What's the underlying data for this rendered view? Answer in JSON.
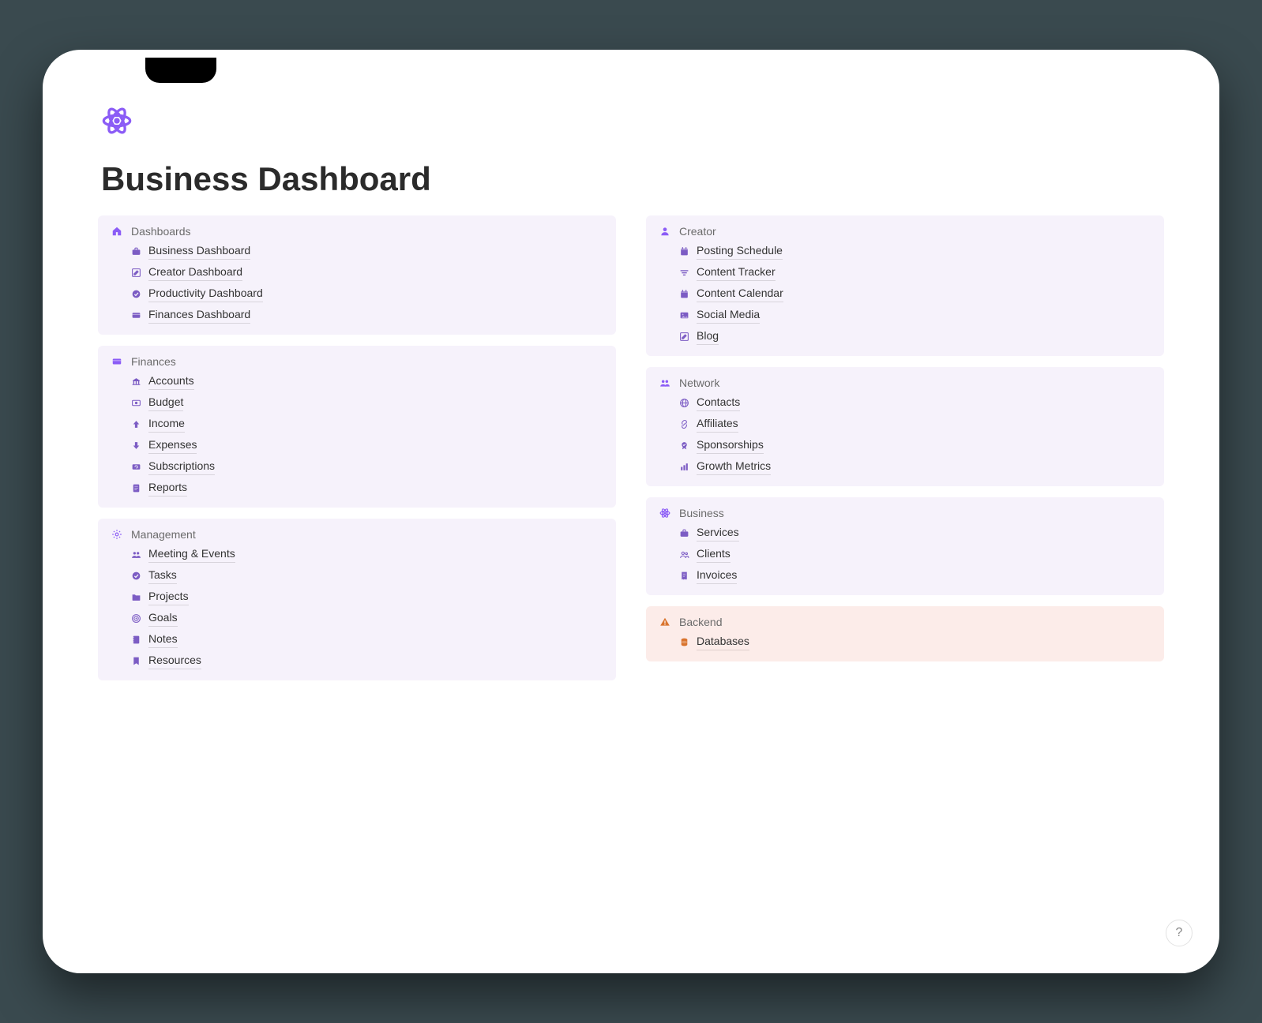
{
  "title": "Business Dashboard",
  "help_label": "?",
  "left": [
    {
      "key": "dashboards",
      "title": "Dashboards",
      "icon": "home-icon",
      "items": [
        {
          "icon": "briefcase-icon",
          "label": "Business Dashboard"
        },
        {
          "icon": "compose-icon",
          "label": "Creator Dashboard"
        },
        {
          "icon": "check-circle-icon",
          "label": "Productivity Dashboard"
        },
        {
          "icon": "card-icon",
          "label": "Finances Dashboard"
        }
      ]
    },
    {
      "key": "finances",
      "title": "Finances",
      "icon": "card-icon",
      "items": [
        {
          "icon": "bank-icon",
          "label": "Accounts"
        },
        {
          "icon": "money-icon",
          "label": "Budget"
        },
        {
          "icon": "arrow-up-icon",
          "label": "Income"
        },
        {
          "icon": "arrow-down-icon",
          "label": "Expenses"
        },
        {
          "icon": "refresh-icon",
          "label": "Subscriptions"
        },
        {
          "icon": "document-icon",
          "label": "Reports"
        }
      ]
    },
    {
      "key": "management",
      "title": "Management",
      "icon": "gear-icon",
      "items": [
        {
          "icon": "people-icon",
          "label": "Meeting & Events"
        },
        {
          "icon": "check-circle-icon",
          "label": "Tasks"
        },
        {
          "icon": "folder-icon",
          "label": "Projects"
        },
        {
          "icon": "target-icon",
          "label": "Goals"
        },
        {
          "icon": "note-icon",
          "label": "Notes"
        },
        {
          "icon": "bookmark-icon",
          "label": "Resources"
        }
      ]
    }
  ],
  "right": [
    {
      "key": "creator",
      "title": "Creator",
      "icon": "person-icon",
      "items": [
        {
          "icon": "calendar-icon",
          "label": "Posting Schedule"
        },
        {
          "icon": "list-filter-icon",
          "label": "Content Tracker"
        },
        {
          "icon": "calendar-icon",
          "label": "Content Calendar"
        },
        {
          "icon": "image-icon",
          "label": "Social Media"
        },
        {
          "icon": "compose-icon",
          "label": "Blog"
        }
      ]
    },
    {
      "key": "network",
      "title": "Network",
      "icon": "people-icon",
      "items": [
        {
          "icon": "globe-icon",
          "label": "Contacts"
        },
        {
          "icon": "link-icon",
          "label": "Affiliates"
        },
        {
          "icon": "badge-icon",
          "label": "Sponsorships"
        },
        {
          "icon": "chart-icon",
          "label": "Growth Metrics"
        }
      ]
    },
    {
      "key": "business",
      "title": "Business",
      "icon": "atom-icon",
      "items": [
        {
          "icon": "briefcase-icon",
          "label": "Services"
        },
        {
          "icon": "members-icon",
          "label": "Clients"
        },
        {
          "icon": "receipt-icon",
          "label": "Invoices"
        }
      ]
    },
    {
      "key": "backend",
      "title": "Backend",
      "icon": "warning-icon",
      "danger": true,
      "items": [
        {
          "icon": "database-icon",
          "label": "Databases"
        }
      ]
    }
  ]
}
